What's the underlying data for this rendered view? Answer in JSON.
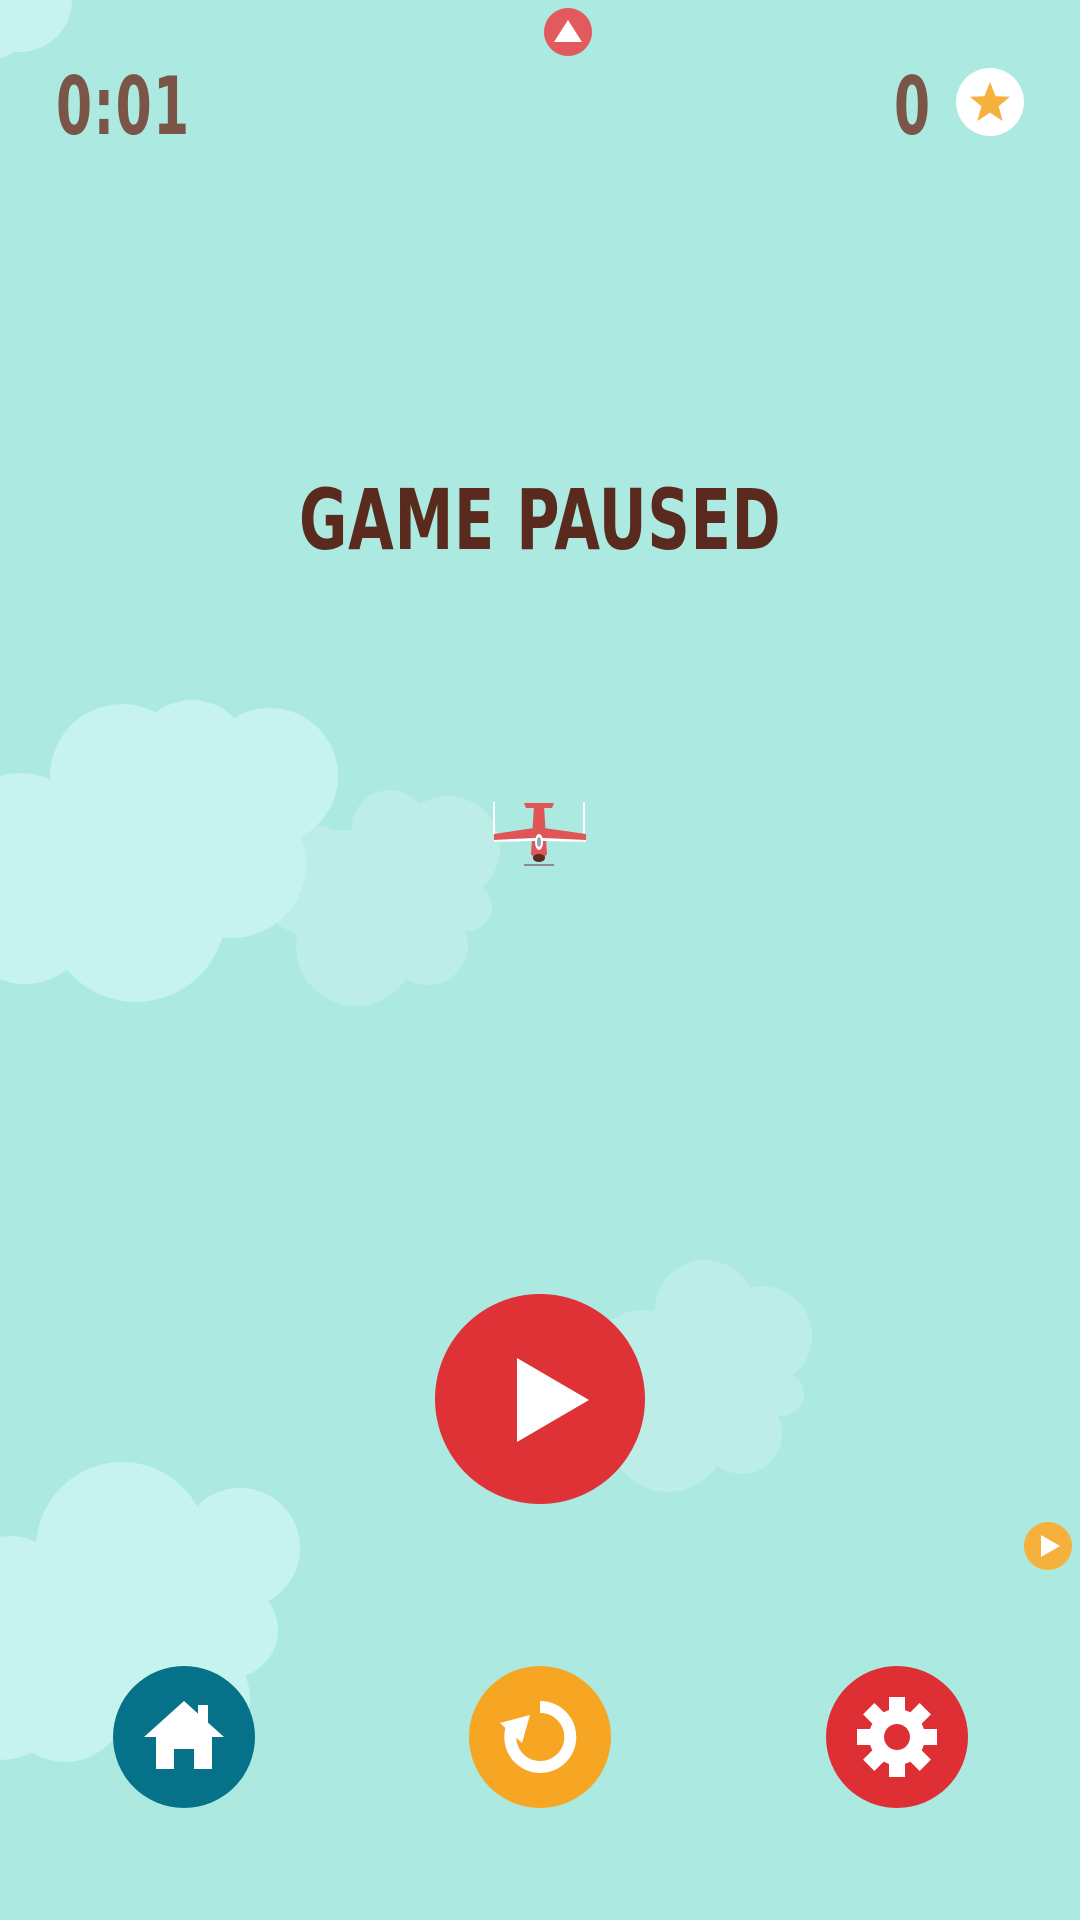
{
  "hud": {
    "timer": "0:01",
    "stars_count": "0"
  },
  "overlay": {
    "title": "GAME PAUSED"
  },
  "colors": {
    "background": "#ABE9E1",
    "hud_text": "#7A5548",
    "title_text": "#5A2A1E",
    "play_button": "#DE3236",
    "home_button": "#05728A",
    "restart_button": "#F6A623",
    "settings_button": "#DE2F35",
    "star": "#F5B13B"
  },
  "icons": {
    "star_badge": "star-icon",
    "top_indicator": "triangle-up-icon",
    "play": "play-icon",
    "side_indicator": "play-icon",
    "home": "home-icon",
    "restart": "restart-icon",
    "settings": "gear-icon",
    "player": "red-airplane"
  }
}
